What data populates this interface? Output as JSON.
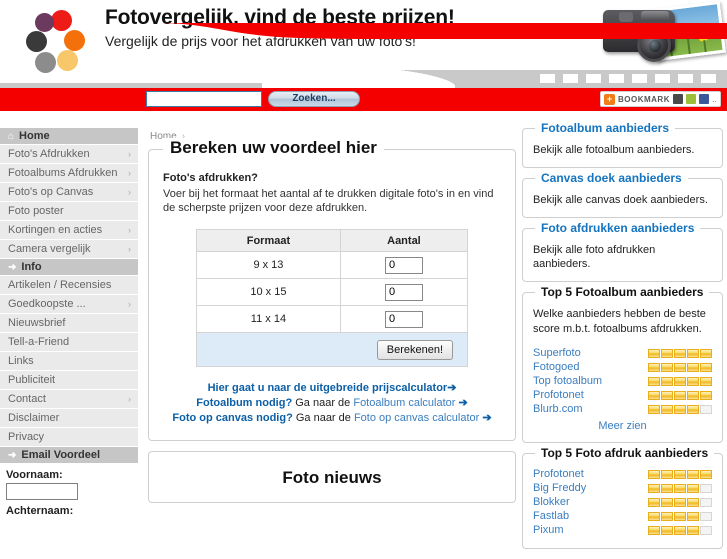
{
  "header": {
    "title": "Fotovergelijk, vind de beste prijzen!",
    "subtitle": "Vergelijk de prijs voor het afdrukken van uw foto's!",
    "logo_colors": [
      "#ed1c16",
      "#6b3a5e",
      "#3a3a3a",
      "#8c8c8c",
      "#f7c76a",
      "#f4700a"
    ]
  },
  "search": {
    "value": "",
    "placeholder": "",
    "button_label": "Zoeken...",
    "bar_color": "#f50000"
  },
  "bookmark": {
    "plus": "+",
    "label": "BOOKMARK"
  },
  "breadcrumb": {
    "home": "Home",
    "separator": "›"
  },
  "sidebar": {
    "groups": [
      {
        "header": {
          "label": "Home",
          "icon": "home-icon",
          "glyph": "⌂"
        },
        "items": [
          {
            "label": "Foto's Afdrukken",
            "arrow": "›"
          },
          {
            "label": "Fotoalbums Afdrukken",
            "arrow": "›"
          },
          {
            "label": "Foto's op Canvas",
            "arrow": "›"
          },
          {
            "label": "Foto poster",
            "arrow": ""
          },
          {
            "label": "Kortingen en acties",
            "arrow": "›"
          },
          {
            "label": "Camera vergelijk",
            "arrow": "›"
          }
        ]
      },
      {
        "header": {
          "label": "Info",
          "icon": "arrow-right-icon",
          "glyph": "➜"
        },
        "items": [
          {
            "label": "Artikelen / Recensies",
            "arrow": ""
          },
          {
            "label": "Goedkoopste ...",
            "arrow": "›"
          },
          {
            "label": "Nieuwsbrief",
            "arrow": ""
          },
          {
            "label": "Tell-a-Friend",
            "arrow": ""
          },
          {
            "label": "Links",
            "arrow": ""
          },
          {
            "label": "Publiciteit",
            "arrow": ""
          },
          {
            "label": "Contact",
            "arrow": "›"
          },
          {
            "label": "Disclaimer",
            "arrow": ""
          },
          {
            "label": "Privacy",
            "arrow": ""
          }
        ]
      },
      {
        "header": {
          "label": "Email Voordeel",
          "icon": "arrow-right-icon",
          "glyph": "➜"
        },
        "items": []
      }
    ],
    "form": {
      "firstname_label": "Voornaam:",
      "firstname_value": "",
      "lastname_label": "Achternaam:"
    }
  },
  "calculator": {
    "title": "Bereken uw voordeel hier",
    "subtitle": "Foto's afdrukken?",
    "description": "Voer bij het formaat het aantal af te drukken digitale foto's in en vind de scherpste prijzen voor deze afdrukken.",
    "columns": [
      "Formaat",
      "Aantal"
    ],
    "rows": [
      {
        "formaat": "9 x 13",
        "aantal": "0"
      },
      {
        "formaat": "10 x 15",
        "aantal": "0"
      },
      {
        "formaat": "11 x 14",
        "aantal": "0"
      }
    ],
    "submit_label": "Berekenen!",
    "links": [
      {
        "bold": "Hier gaat u naar de uitgebreide prijscalculator",
        "plain": "",
        "link": "",
        "arrow": "➔"
      },
      {
        "bold": "Fotoalbum nodig?",
        "plain": " Ga naar de ",
        "link": "Fotoalbum calculator",
        "arrow": "➔"
      },
      {
        "bold": "Foto op canvas nodig?",
        "plain": " Ga naar de ",
        "link": "Foto op canvas calculator",
        "arrow": "➔"
      }
    ]
  },
  "news": {
    "title": "Foto nieuws"
  },
  "right": {
    "providers": [
      {
        "legend": "Fotoalbum aanbieders",
        "text": "Bekijk alle fotoalbum aanbieders."
      },
      {
        "legend": "Canvas doek aanbieders",
        "text": "Bekijk alle canvas doek aanbieders."
      },
      {
        "legend": "Foto afdrukken aanbieders",
        "text": "Bekijk alle foto afdrukken aanbieders."
      }
    ],
    "top_album": {
      "legend": "Top 5 Fotoalbum aanbieders",
      "intro": "Welke aanbieders hebben de beste score m.b.t. fotoalbums afdrukken.",
      "items": [
        {
          "name": "Superfoto",
          "rating": 5
        },
        {
          "name": "Fotogoed",
          "rating": 5
        },
        {
          "name": "Top fotoalbum",
          "rating": 5
        },
        {
          "name": "Profotonet",
          "rating": 5
        },
        {
          "name": "Blurb.com",
          "rating": 4
        }
      ],
      "more": "Meer zien"
    },
    "top_print": {
      "legend": "Top 5 Foto afdruk aanbieders",
      "items": [
        {
          "name": "Profotonet",
          "rating": 5
        },
        {
          "name": "Big Freddy",
          "rating": 4
        },
        {
          "name": "Blokker",
          "rating": 4
        },
        {
          "name": "Fastlab",
          "rating": 4
        },
        {
          "name": "Pixum",
          "rating": 4
        }
      ]
    }
  }
}
